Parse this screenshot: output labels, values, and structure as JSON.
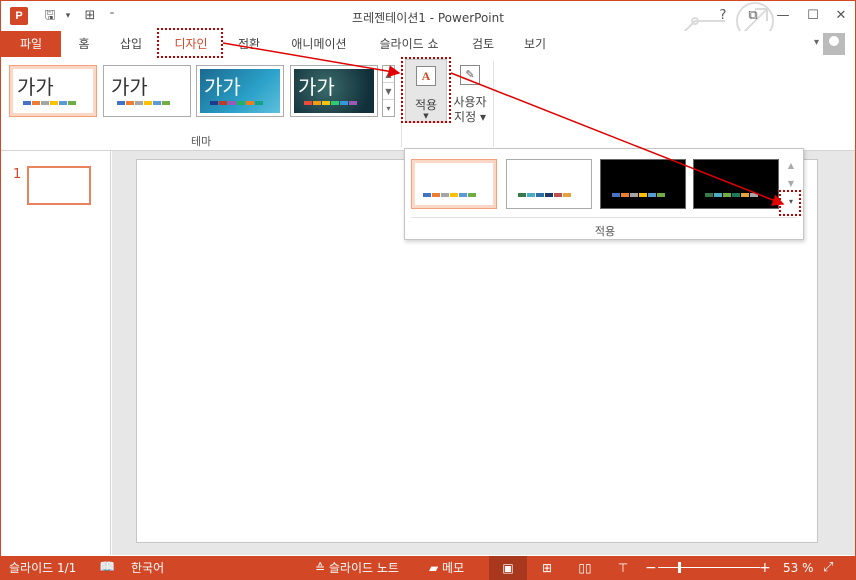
{
  "titlebar": {
    "app_icon": "P",
    "title": "프레젠테이션1 - PowerPoint",
    "qat_icons": [
      "save-icon",
      "undo-icon",
      "grid-icon",
      "customize-icon"
    ],
    "help": "?",
    "ribbon_display": "⧉",
    "minimize": "—",
    "maximize": "☐",
    "close": "✕"
  },
  "tabs": {
    "file": "파일",
    "items": [
      "홈",
      "삽입",
      "디자인",
      "전환",
      "애니메이션",
      "슬라이드 쇼",
      "검토",
      "보기"
    ],
    "active": "디자인"
  },
  "ribbon": {
    "themes": [
      {
        "text": "가가",
        "style": "office",
        "selected": true
      },
      {
        "text": "가가",
        "style": "office2",
        "selected": false
      },
      {
        "text": "가가",
        "style": "facet",
        "selected": false
      },
      {
        "text": "가가",
        "style": "ion",
        "selected": false
      }
    ],
    "themes_group_label": "테마",
    "apply_button_label": "적용",
    "custom_button_label_1": "사용자",
    "custom_button_label_2": "지정"
  },
  "slides_pane": {
    "slide_number": "1"
  },
  "apply_dropdown": {
    "themes": [
      {
        "style": "light",
        "selected": true
      },
      {
        "style": "light",
        "selected": false
      },
      {
        "style": "dark",
        "selected": false
      },
      {
        "style": "dark",
        "selected": false
      }
    ],
    "label": "적용"
  },
  "colors": {
    "accent": "#d24726",
    "highlight": "#c00000"
  },
  "statusbar": {
    "slide_info": "슬라이드 1/1",
    "language": "한국어",
    "notes": "슬라이드 노트",
    "comments": "메모",
    "zoom": "53 %"
  }
}
